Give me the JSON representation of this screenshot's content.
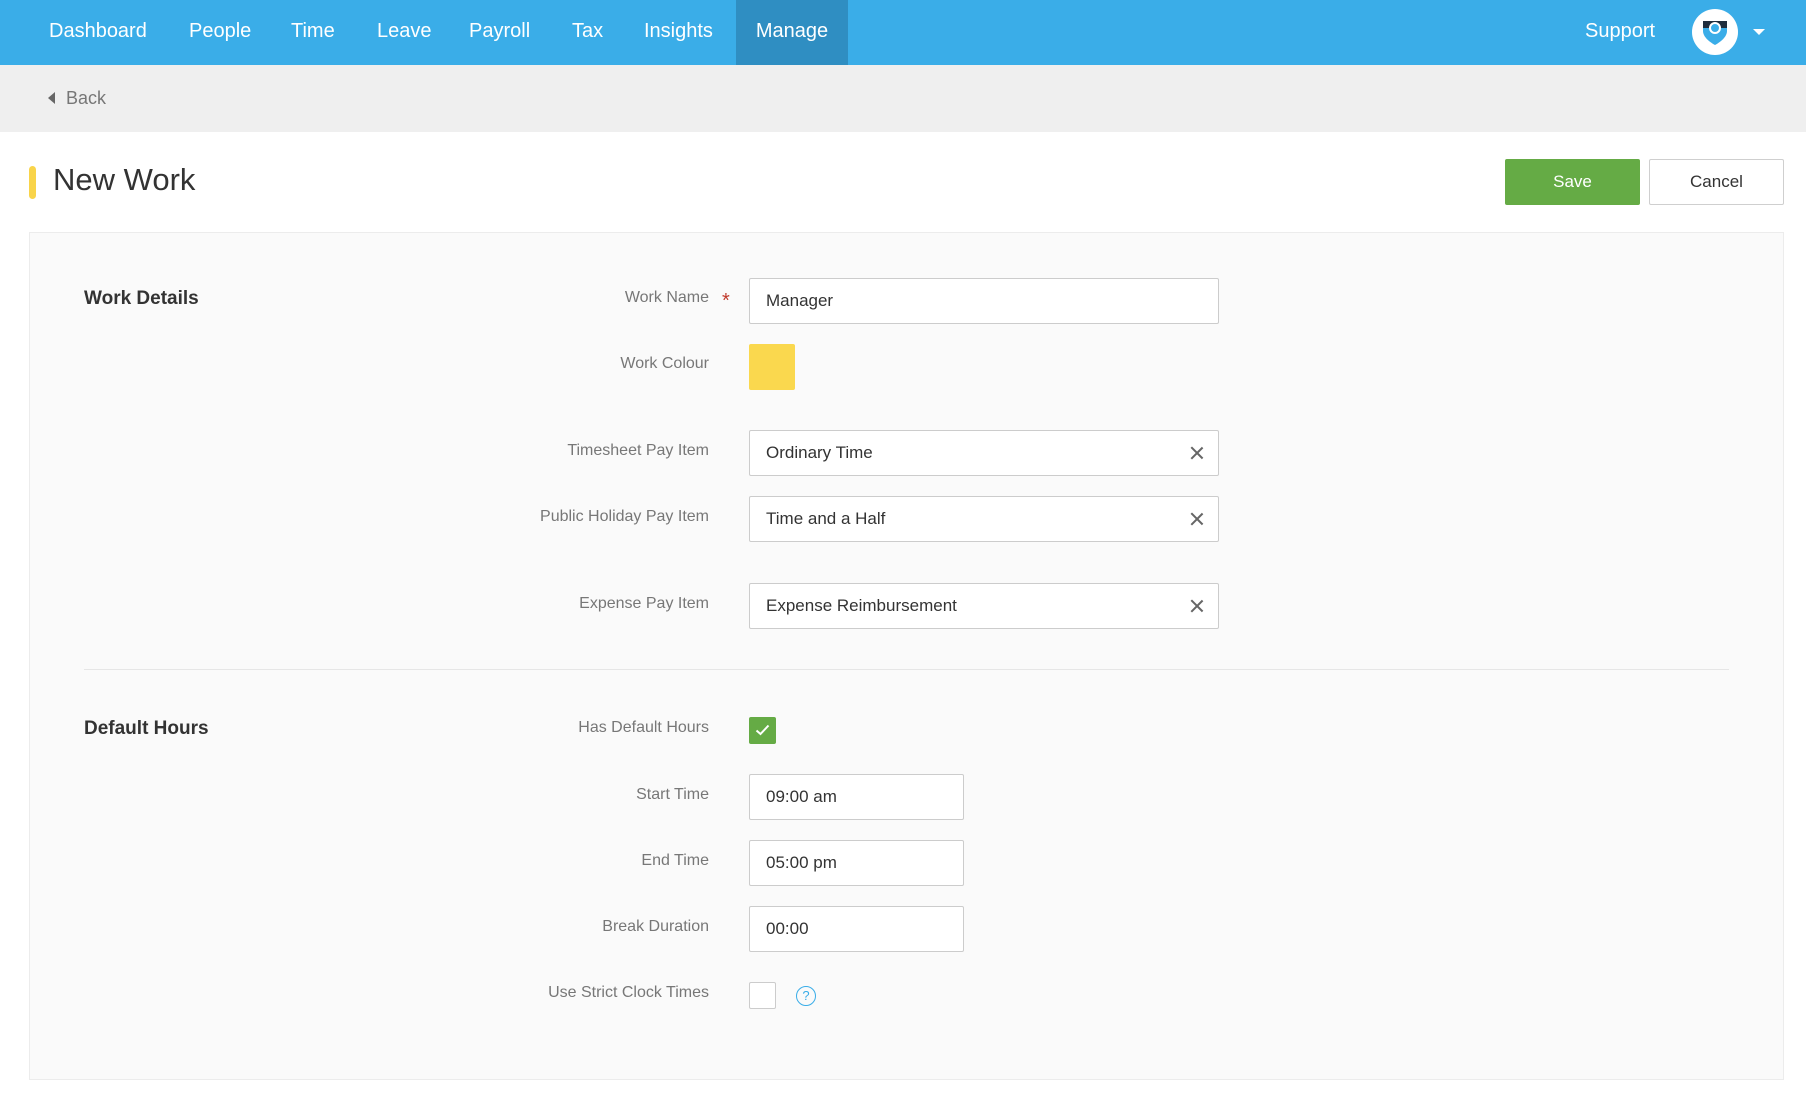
{
  "nav": {
    "items": [
      {
        "label": "Dashboard",
        "active": false
      },
      {
        "label": "People",
        "active": false
      },
      {
        "label": "Time",
        "active": false
      },
      {
        "label": "Leave",
        "active": false
      },
      {
        "label": "Payroll",
        "active": false
      },
      {
        "label": "Tax",
        "active": false
      },
      {
        "label": "Insights",
        "active": false
      },
      {
        "label": "Manage",
        "active": true
      }
    ],
    "support": "Support"
  },
  "back": {
    "label": "Back"
  },
  "header": {
    "title": "New Work",
    "save": "Save",
    "cancel": "Cancel"
  },
  "work_details": {
    "section_title": "Work Details",
    "work_name_label": "Work Name",
    "work_name_required": "*",
    "work_name_value": "Manager",
    "work_colour_label": "Work Colour",
    "work_colour": "#fad84e",
    "timesheet_label": "Timesheet Pay Item",
    "timesheet_value": "Ordinary Time",
    "public_holiday_label": "Public Holiday Pay Item",
    "public_holiday_value": "Time and a Half",
    "expense_label": "Expense Pay Item",
    "expense_value": "Expense Reimbursement"
  },
  "default_hours": {
    "section_title": "Default Hours",
    "has_default_label": "Has Default Hours",
    "has_default_checked": true,
    "start_label": "Start Time",
    "start_value": "09:00  am",
    "end_label": "End Time",
    "end_value": "05:00  pm",
    "break_label": "Break Duration",
    "break_value": "00:00",
    "strict_label": "Use Strict Clock Times",
    "strict_checked": false,
    "help_glyph": "?"
  },
  "colors": {
    "nav_bg": "#3aade8",
    "nav_active": "#2f8ec2",
    "save_green": "#65ab45",
    "accent_yellow": "#f9d44a"
  }
}
